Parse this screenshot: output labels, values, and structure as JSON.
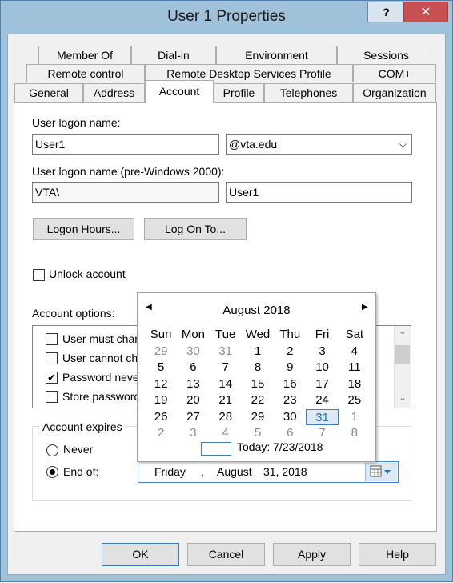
{
  "window": {
    "title": "User 1 Properties",
    "help_label": "?",
    "close_label": "✕"
  },
  "tabs": {
    "row1": [
      "Member Of",
      "Dial-in",
      "Environment",
      "Sessions"
    ],
    "row2": [
      "Remote control",
      "Remote Desktop Services Profile",
      "COM+"
    ],
    "row3": [
      "General",
      "Address",
      "Account",
      "Profile",
      "Telephones",
      "Organization"
    ],
    "active": "Account"
  },
  "account": {
    "logon_name_label": "User logon name:",
    "logon_name_value": "User1",
    "domain_value": "@vta.edu",
    "pre2000_label": "User logon name (pre-Windows 2000):",
    "pre2000_domain": "VTA\\",
    "pre2000_user": "User1",
    "logon_hours_label": "Logon Hours...",
    "log_on_to_label": "Log On To...",
    "unlock_label": "Unlock account",
    "options_label": "Account options:",
    "options": [
      {
        "label": "User must char",
        "checked": false
      },
      {
        "label": "User cannot ch",
        "checked": false
      },
      {
        "label": "Password neve",
        "checked": true
      },
      {
        "label": "Store password",
        "checked": false
      }
    ],
    "expires_label": "Account expires",
    "never_label": "Never",
    "end_of_label": "End of:",
    "date_day": "Friday",
    "date_sep": ",",
    "date_month": "August",
    "date_rest": "31, 2018"
  },
  "calendar": {
    "month_label": "August 2018",
    "weekdays": [
      "Sun",
      "Mon",
      "Tue",
      "Wed",
      "Thu",
      "Fri",
      "Sat"
    ],
    "weeks": [
      [
        "29",
        "30",
        "31",
        "1",
        "2",
        "3",
        "4"
      ],
      [
        "5",
        "6",
        "7",
        "8",
        "9",
        "10",
        "11"
      ],
      [
        "12",
        "13",
        "14",
        "15",
        "16",
        "17",
        "18"
      ],
      [
        "19",
        "20",
        "21",
        "22",
        "23",
        "24",
        "25"
      ],
      [
        "26",
        "27",
        "28",
        "29",
        "30",
        "31",
        "1"
      ],
      [
        "2",
        "3",
        "4",
        "5",
        "6",
        "7",
        "8"
      ]
    ],
    "selected_day": "31",
    "today_label": "Today: 7/23/2018"
  },
  "buttons": {
    "ok": "OK",
    "cancel": "Cancel",
    "apply": "Apply",
    "help": "Help"
  },
  "colors": {
    "title_bar": "#9fc1d9",
    "close": "#c75050",
    "selection": "#3c7fb1"
  }
}
